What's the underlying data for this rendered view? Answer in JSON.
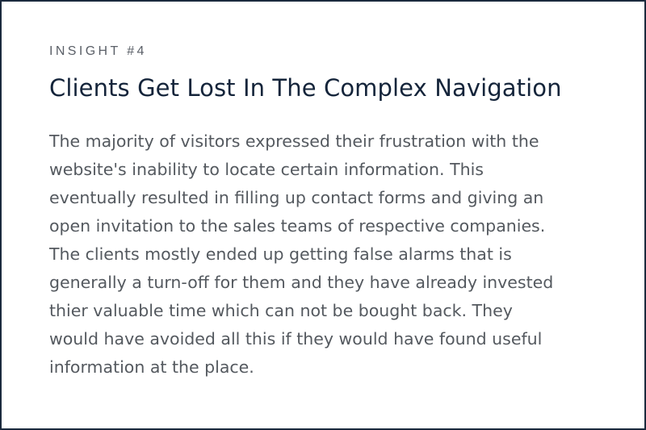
{
  "insight": {
    "eyebrow": "INSIGHT #4",
    "title": "Clients Get Lost In The Complex Navigation",
    "body_lines": [
      "The majority of visitors expressed their frustration with the",
      "website's inability to locate certain information. This",
      "eventually resulted in filling up contact forms and giving an",
      "open invitation to the sales teams of respective companies.",
      "The clients mostly ended up getting false alarms that is",
      "generally a turn-off for them and they have already invested",
      "thier valuable time which can not be bought back. They",
      "would have avoided all this if they would have found useful",
      "information at the place."
    ]
  },
  "colors": {
    "border": "#1b2a3d",
    "title": "#14243a",
    "eyebrow": "#5b6068",
    "body": "#54595f",
    "background": "#ffffff"
  }
}
